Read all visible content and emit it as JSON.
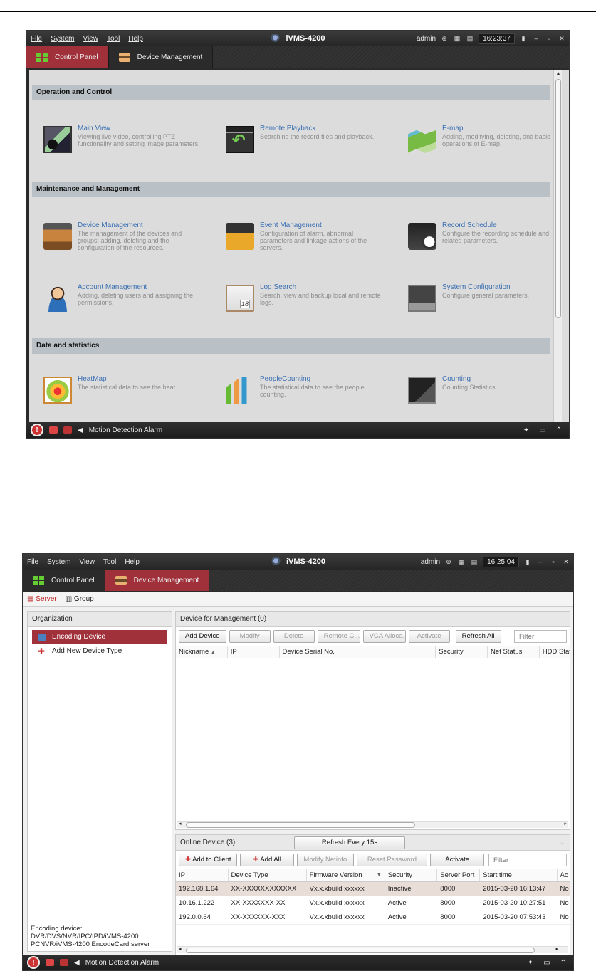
{
  "window1": {
    "menu": [
      "File",
      "System",
      "View",
      "Tool",
      "Help"
    ],
    "app_title": "iVMS-4200",
    "user": "admin",
    "clock": "16:23:37",
    "tabs": [
      "Control Panel",
      "Device Management"
    ],
    "sections": [
      {
        "title": "Operation and Control"
      },
      {
        "title": "Maintenance and Management"
      },
      {
        "title": "Data and statistics"
      }
    ],
    "modules": {
      "main_view": {
        "title": "Main View",
        "desc": "Viewing live video, controlling PTZ functionality and setting image parameters."
      },
      "remote_playback": {
        "title": "Remote Playback",
        "desc": "Searching the record files and playback."
      },
      "emap": {
        "title": "E-map",
        "desc": "Adding, modifying, deleting, and basic operations of E-map."
      },
      "device_management": {
        "title": "Device Management",
        "desc": "The management of the devices and groups: adding, deleting,and the configuration of the resources."
      },
      "event_management": {
        "title": "Event Management",
        "desc": "Configuration of alarm, abnormal parameters and linkage actions of the servers."
      },
      "record_schedule": {
        "title": "Record Schedule",
        "desc": "Configure the recording schedule and related parameters."
      },
      "account_management": {
        "title": "Account Management",
        "desc": "Adding, deleting users and assigning the permissions."
      },
      "log_search": {
        "title": "Log Search",
        "desc": "Search, view and backup local and remote logs."
      },
      "system_configuration": {
        "title": "System Configuration",
        "desc": "Configure general parameters."
      },
      "heatmap": {
        "title": "HeatMap",
        "desc": "The statistical data to see the heat."
      },
      "people_counting": {
        "title": "PeopleCounting",
        "desc": "The statistical data to see the people counting."
      },
      "counting": {
        "title": "Counting",
        "desc": "Counting Statistics"
      }
    },
    "status": "Motion Detection Alarm"
  },
  "window2": {
    "menu": [
      "File",
      "System",
      "View",
      "Tool",
      "Help"
    ],
    "app_title": "iVMS-4200",
    "user": "admin",
    "clock": "16:25:04",
    "tabs": [
      "Control Panel",
      "Device Management"
    ],
    "subtabs": [
      "Server",
      "Group"
    ],
    "organization": {
      "title": "Organization",
      "items": [
        "Encoding Device",
        "Add New Device Type"
      ],
      "footer": "Encoding device: DVR/DVS/NVR/IPC/IPD/iVMS-4200 PCNVR/iVMS-4200 EncodeCard server"
    },
    "device_mgmt": {
      "title": "Device for Management (0)",
      "buttons": [
        "Add Device",
        "Modify",
        "Delete",
        "Remote C...",
        "VCA Alloca...",
        "Activate",
        "Refresh All"
      ],
      "filter_placeholder": "Filter",
      "columns": [
        "Nickname",
        "IP",
        "Device Serial No.",
        "Security",
        "Net Status",
        "HDD Statu"
      ]
    },
    "online": {
      "title": "Online Device (3)",
      "refresh": "Refresh Every 15s",
      "buttons": [
        "Add to Client",
        "Add All",
        "Modify Netinfo",
        "Reset Password",
        "Activate"
      ],
      "filter_placeholder": "Filter",
      "columns": [
        "IP",
        "Device Type",
        "Firmware Version",
        "Security",
        "Server Port",
        "Start time",
        "Ac"
      ],
      "rows": [
        [
          "192.168.1.64",
          "XX-XXXXXXXXXXXX",
          "Vx.x.xbuild xxxxxx",
          "Inactive",
          "8000",
          "2015-03-20 16:13:47",
          "No"
        ],
        [
          "10.16.1.222",
          "XX-XXXXXXX-XX",
          "Vx.x.xbuild xxxxxx",
          "Active",
          "8000",
          "2015-03-20 10:27:51",
          "No"
        ],
        [
          "192.0.0.64",
          "XX-XXXXXX-XXX",
          "Vx.x.xbuild xxxxxx",
          "Active",
          "8000",
          "2015-03-20 07:53:43",
          "No"
        ]
      ]
    },
    "status": "Motion Detection Alarm"
  }
}
